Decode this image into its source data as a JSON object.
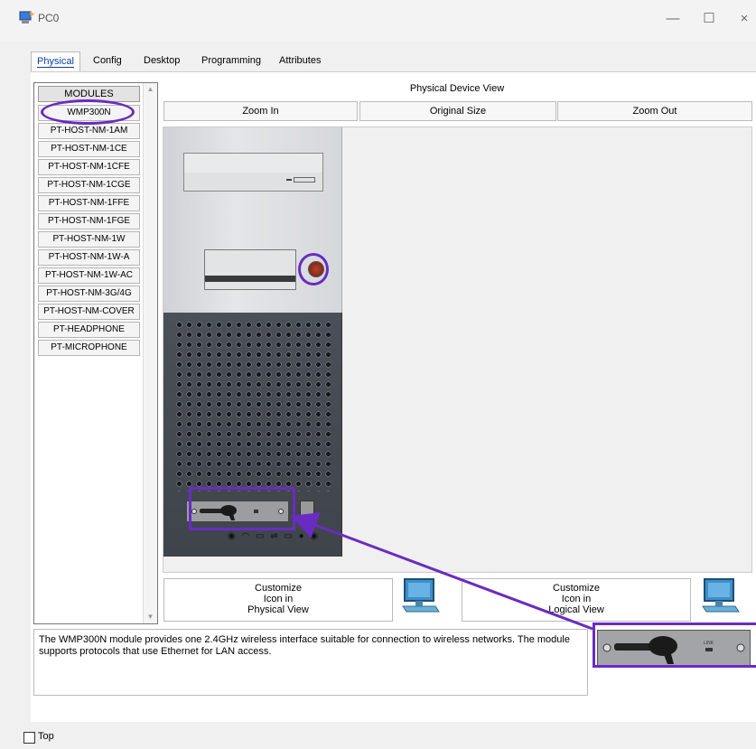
{
  "window": {
    "title": "PC0",
    "minimize": "—",
    "maximize": "☐",
    "close": "×"
  },
  "tabs": [
    "Physical",
    "Config",
    "Desktop",
    "Programming",
    "Attributes"
  ],
  "modules": {
    "header": "MODULES",
    "items": [
      "WMP300N",
      "PT-HOST-NM-1AM",
      "PT-HOST-NM-1CE",
      "PT-HOST-NM-1CFE",
      "PT-HOST-NM-1CGE",
      "PT-HOST-NM-1FFE",
      "PT-HOST-NM-1FGE",
      "PT-HOST-NM-1W",
      "PT-HOST-NM-1W-A",
      "PT-HOST-NM-1W-AC",
      "PT-HOST-NM-3G/4G",
      "PT-HOST-NM-COVER",
      "PT-HEADPHONE",
      "PT-MICROPHONE"
    ]
  },
  "device_view": {
    "title": "Physical Device View",
    "zoom_in": "Zoom In",
    "original_size": "Original Size",
    "zoom_out": "Zoom Out"
  },
  "customize": {
    "physical": {
      "line1": "Customize",
      "line2": "Icon in",
      "line3": "Physical View"
    },
    "logical": {
      "line1": "Customize",
      "line2": "Icon in",
      "line3": "Logical View"
    }
  },
  "description": "The WMP300N module provides one 2.4GHz wireless interface suitable for connection to wireless networks. The module supports protocols that use Ethernet for LAN access.",
  "preview_label": "LINK",
  "bottom": {
    "top_checkbox_label": "Top"
  },
  "colors": {
    "annotation": "#6a2bc2",
    "active_tab_text": "#0b3ea6"
  }
}
